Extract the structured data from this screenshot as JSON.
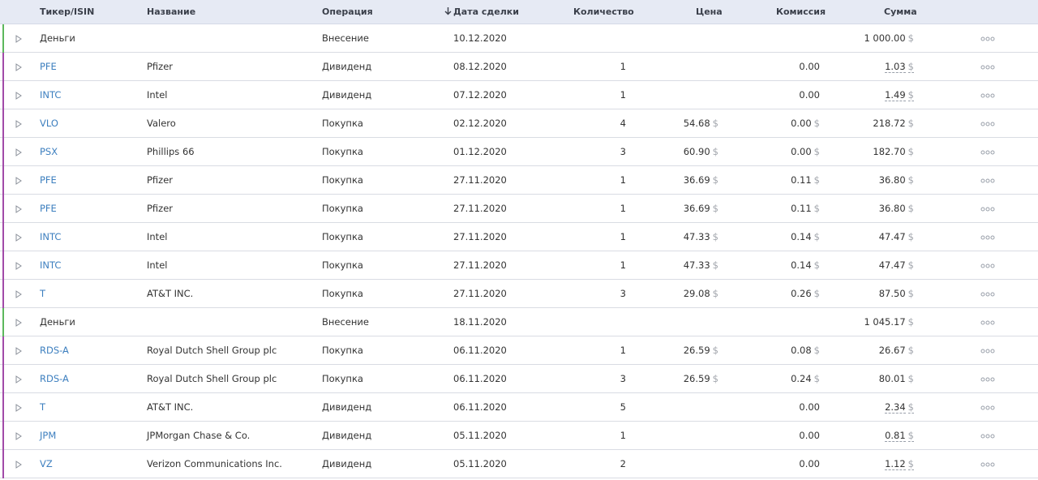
{
  "header": {
    "ticker": "Тикер/ISIN",
    "name": "Название",
    "operation": "Операция",
    "date": "Дата сделки",
    "quantity": "Количество",
    "price": "Цена",
    "commission": "Комиссия",
    "sum": "Сумма"
  },
  "currency_symbol": "$",
  "colors": {
    "accent_link": "#3d7fbf",
    "bar_cash": "#5cb85c",
    "bar_trade": "#a24aa8",
    "header_bg": "#e6eaf4"
  },
  "icons": {
    "expand": "triangle-right-icon",
    "more": "more-dots-icon",
    "sort": "arrow-down-icon"
  },
  "rows": [
    {
      "ticker": "Деньги",
      "name": "",
      "operation": "Внесение",
      "date": "10.12.2020",
      "quantity": "",
      "price": "",
      "commission": "",
      "sum": "1 000.00",
      "kind": "cash",
      "sum_dashed": false
    },
    {
      "ticker": "PFE",
      "name": "Pfizer",
      "operation": "Дивиденд",
      "date": "08.12.2020",
      "quantity": "1",
      "price": "",
      "commission": "0.00",
      "sum": "1.03",
      "kind": "trade",
      "sum_dashed": true
    },
    {
      "ticker": "INTC",
      "name": "Intel",
      "operation": "Дивиденд",
      "date": "07.12.2020",
      "quantity": "1",
      "price": "",
      "commission": "0.00",
      "sum": "1.49",
      "kind": "trade",
      "sum_dashed": true
    },
    {
      "ticker": "VLO",
      "name": "Valero",
      "operation": "Покупка",
      "date": "02.12.2020",
      "quantity": "4",
      "price": "54.68",
      "commission": "0.00",
      "sum": "218.72",
      "kind": "trade",
      "sum_dashed": false
    },
    {
      "ticker": "PSX",
      "name": "Phillips 66",
      "operation": "Покупка",
      "date": "01.12.2020",
      "quantity": "3",
      "price": "60.90",
      "commission": "0.00",
      "sum": "182.70",
      "kind": "trade",
      "sum_dashed": false
    },
    {
      "ticker": "PFE",
      "name": "Pfizer",
      "operation": "Покупка",
      "date": "27.11.2020",
      "quantity": "1",
      "price": "36.69",
      "commission": "0.11",
      "sum": "36.80",
      "kind": "trade",
      "sum_dashed": false
    },
    {
      "ticker": "PFE",
      "name": "Pfizer",
      "operation": "Покупка",
      "date": "27.11.2020",
      "quantity": "1",
      "price": "36.69",
      "commission": "0.11",
      "sum": "36.80",
      "kind": "trade",
      "sum_dashed": false
    },
    {
      "ticker": "INTC",
      "name": "Intel",
      "operation": "Покупка",
      "date": "27.11.2020",
      "quantity": "1",
      "price": "47.33",
      "commission": "0.14",
      "sum": "47.47",
      "kind": "trade",
      "sum_dashed": false
    },
    {
      "ticker": "INTC",
      "name": "Intel",
      "operation": "Покупка",
      "date": "27.11.2020",
      "quantity": "1",
      "price": "47.33",
      "commission": "0.14",
      "sum": "47.47",
      "kind": "trade",
      "sum_dashed": false
    },
    {
      "ticker": "T",
      "name": "AT&T INC.",
      "operation": "Покупка",
      "date": "27.11.2020",
      "quantity": "3",
      "price": "29.08",
      "commission": "0.26",
      "sum": "87.50",
      "kind": "trade",
      "sum_dashed": false
    },
    {
      "ticker": "Деньги",
      "name": "",
      "operation": "Внесение",
      "date": "18.11.2020",
      "quantity": "",
      "price": "",
      "commission": "",
      "sum": "1 045.17",
      "kind": "cash",
      "sum_dashed": false
    },
    {
      "ticker": "RDS-A",
      "name": "Royal Dutch Shell Group plc",
      "operation": "Покупка",
      "date": "06.11.2020",
      "quantity": "1",
      "price": "26.59",
      "commission": "0.08",
      "sum": "26.67",
      "kind": "trade",
      "sum_dashed": false
    },
    {
      "ticker": "RDS-A",
      "name": "Royal Dutch Shell Group plc",
      "operation": "Покупка",
      "date": "06.11.2020",
      "quantity": "3",
      "price": "26.59",
      "commission": "0.24",
      "sum": "80.01",
      "kind": "trade",
      "sum_dashed": false
    },
    {
      "ticker": "T",
      "name": "AT&T INC.",
      "operation": "Дивиденд",
      "date": "06.11.2020",
      "quantity": "5",
      "price": "",
      "commission": "0.00",
      "sum": "2.34",
      "kind": "trade",
      "sum_dashed": true
    },
    {
      "ticker": "JPM",
      "name": "JPMorgan Chase & Co.",
      "operation": "Дивиденд",
      "date": "05.11.2020",
      "quantity": "1",
      "price": "",
      "commission": "0.00",
      "sum": "0.81",
      "kind": "trade",
      "sum_dashed": true
    },
    {
      "ticker": "VZ",
      "name": "Verizon Communications Inc.",
      "operation": "Дивиденд",
      "date": "05.11.2020",
      "quantity": "2",
      "price": "",
      "commission": "0.00",
      "sum": "1.12",
      "kind": "trade",
      "sum_dashed": true
    }
  ]
}
